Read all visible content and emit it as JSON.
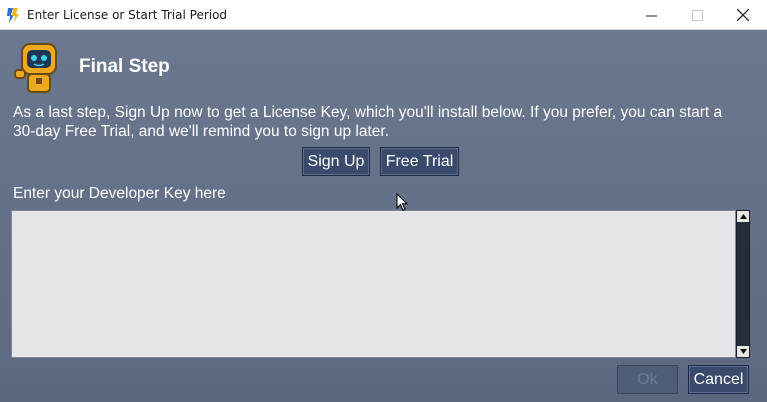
{
  "window": {
    "title": "Enter License or Start Trial Period",
    "minimize_symbol": "—",
    "close_symbol": "✕"
  },
  "header": {
    "title": "Final Step",
    "mascot_icon": "robot-mascot-icon"
  },
  "description": "As a last step, Sign Up now to get a License Key, which you'll install below. If you prefer, you can start a 30-day Free Trial, and we'll remind you to sign up later.",
  "buttons": {
    "sign_up": "Sign Up",
    "free_trial": "Free Trial",
    "ok": "Ok",
    "cancel": "Cancel"
  },
  "key_input": {
    "label": "Enter your Developer Key here",
    "value": ""
  },
  "colors": {
    "background": "#5f6c82",
    "button": "#3a4a6c",
    "input": "#e4e5e9"
  }
}
